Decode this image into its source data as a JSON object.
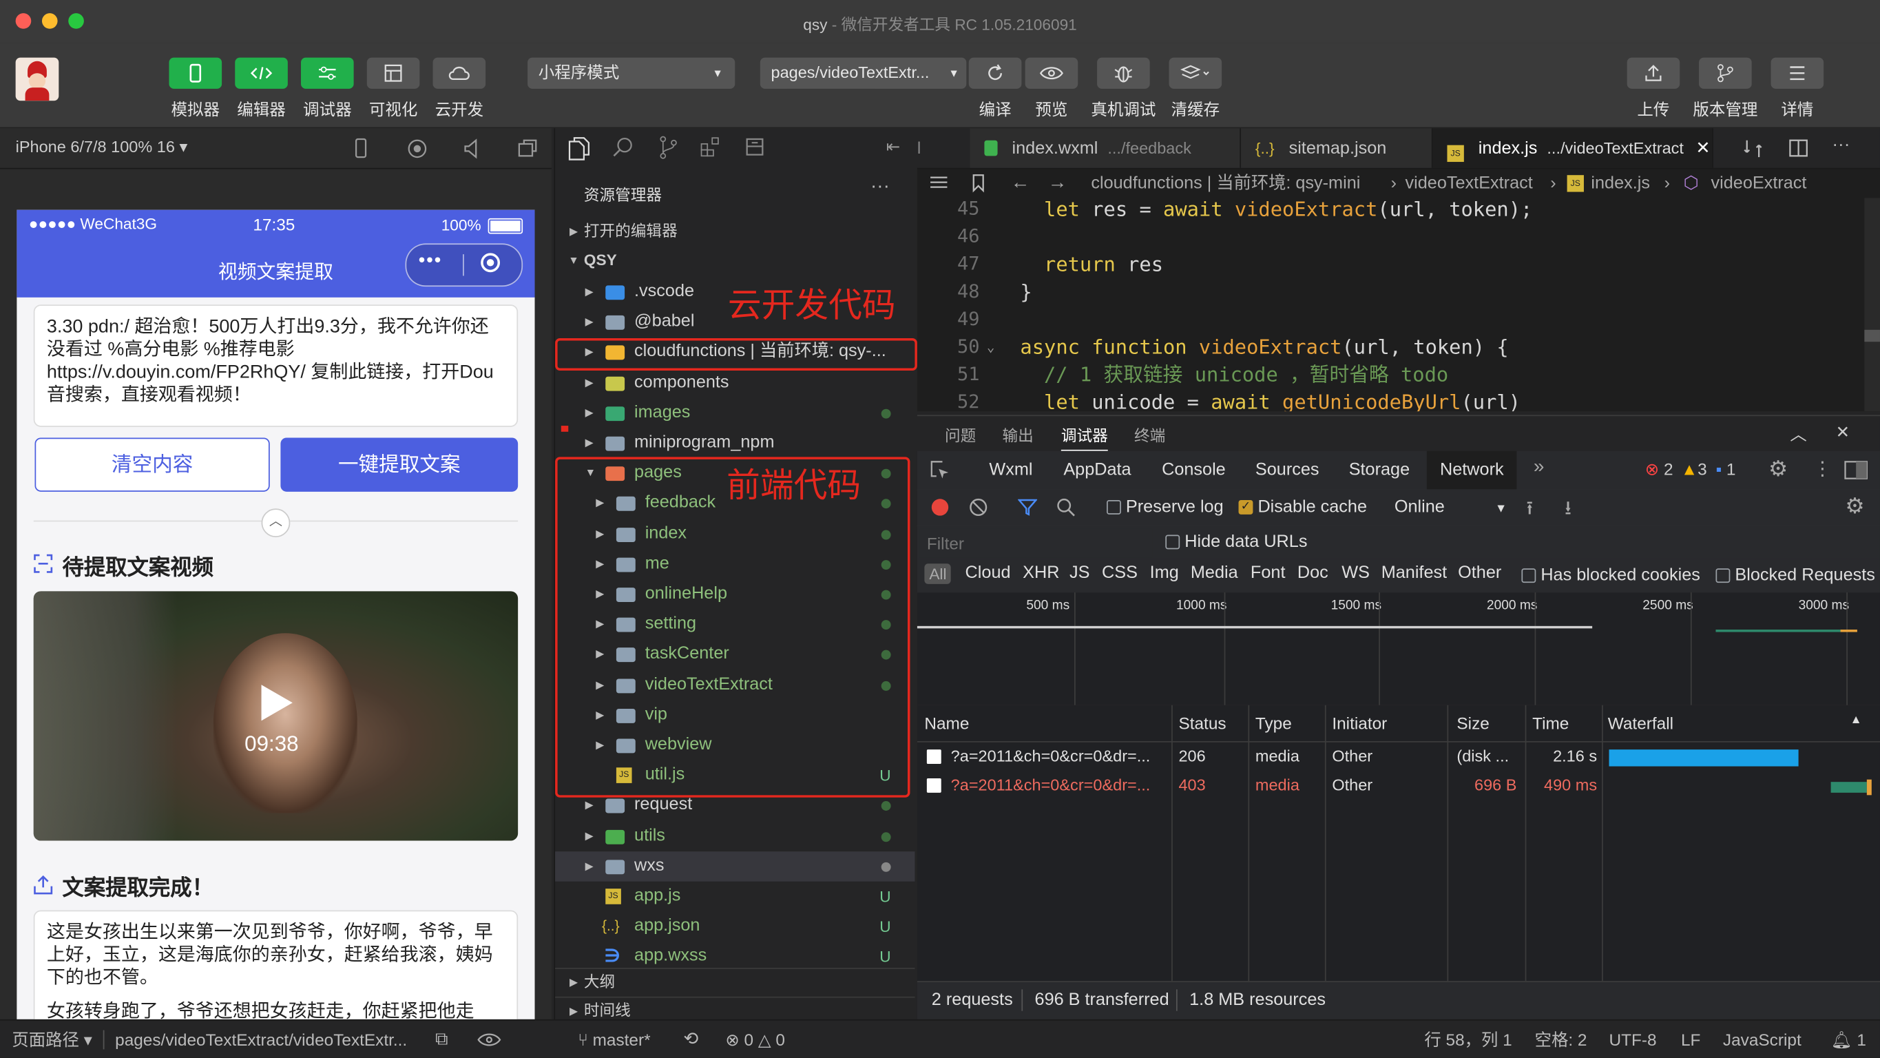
{
  "window": {
    "title": "qsy",
    "subtitle": " - 微信开发者工具 RC 1.05.2106091"
  },
  "toolbar": {
    "simulator": "模拟器",
    "editor": "编辑器",
    "debugger": "调试器",
    "visual": "可视化",
    "cloud": "云开发",
    "mode_select": "小程序模式",
    "page_select": "pages/videoTextExtr...",
    "compile": "编译",
    "preview": "预览",
    "remote_debug": "真机调试",
    "clear_cache": "清缓存",
    "upload": "上传",
    "version": "版本管理",
    "details": "详情"
  },
  "simulator": {
    "device": "iPhone 6/7/8 100% 16",
    "status_left": "●●●●● WeChat3G",
    "status_time": "17:35",
    "status_battery": "100%",
    "nav_title": "视频文案提取",
    "input_text": "3.30 pdn:/ 超治愈！500万人打出9.3分，我不允许你还没看过 %高分电影 %推荐电影  https://v.douyin.com/FP2RhQY/ 复制此链接，打开Dou音搜索，直接观看视频！",
    "clear_button": "清空内容",
    "extract_button": "一键提取文案",
    "pending_title": "待提取文案视频",
    "video_duration": "09:38",
    "done_title": "文案提取完成！",
    "result_text": "这是女孩出生以来第一次见到爷爷，你好啊，爷爷，早上好，玉立，这是海底你的亲孙女，赶紧给我滚，姨妈下的也不管。",
    "result_text_cut": "女孩转身跑了，爷爷还想把女孩赶走，你赶紧把他走"
  },
  "explorer": {
    "header": "资源管理器",
    "open_editors": "打开的编辑器",
    "project": "QSY",
    "items": [
      {
        "name": ".vscode",
        "type": "vscode"
      },
      {
        "name": "@babel",
        "type": "folder"
      },
      {
        "name": "cloudfunctions | 当前环境: qsy-...",
        "type": "cloud"
      },
      {
        "name": "components",
        "type": "comp"
      },
      {
        "name": "images",
        "type": "images"
      },
      {
        "name": "miniprogram_npm",
        "type": "folder"
      },
      {
        "name": "pages",
        "type": "pages"
      },
      {
        "name": "feedback",
        "type": "sub"
      },
      {
        "name": "index",
        "type": "sub"
      },
      {
        "name": "me",
        "type": "sub"
      },
      {
        "name": "onlineHelp",
        "type": "sub"
      },
      {
        "name": "setting",
        "type": "sub"
      },
      {
        "name": "taskCenter",
        "type": "sub"
      },
      {
        "name": "videoTextExtract",
        "type": "sub"
      },
      {
        "name": "vip",
        "type": "sub"
      },
      {
        "name": "webview",
        "type": "sub"
      },
      {
        "name": "util.js",
        "type": "js"
      },
      {
        "name": "request",
        "type": "folder"
      },
      {
        "name": "utils",
        "type": "utils"
      },
      {
        "name": "wxs",
        "type": "folder"
      },
      {
        "name": "app.js",
        "type": "js"
      },
      {
        "name": "app.json",
        "type": "json"
      },
      {
        "name": "app.wxss",
        "type": "wxss"
      }
    ],
    "outline": "大纲",
    "timeline": "时间线",
    "u_badge": "U"
  },
  "annotations": {
    "cloud": "云开发代码",
    "frontend": "前端代码"
  },
  "editor": {
    "tab1": "index.wxml",
    "tab1_path": ".../feedback",
    "tab2": "sitemap.json",
    "tab3": "index.js",
    "tab3_path": ".../videoTextExtract",
    "breadcrumb": [
      "cloudfunctions | 当前环境: qsy-mini",
      "videoTextExtract",
      "index.js",
      "videoExtract"
    ],
    "code": [
      {
        "n": "45",
        "t": "    let res = await videoExtract(url, token);"
      },
      {
        "n": "46",
        "t": ""
      },
      {
        "n": "47",
        "t": "    return res"
      },
      {
        "n": "48",
        "t": "  }"
      },
      {
        "n": "49",
        "t": ""
      },
      {
        "n": "50",
        "t": "  async function videoExtract(url, token) {"
      },
      {
        "n": "51",
        "t": "    // 1 获取链接 unicode ，暂时省略 todo"
      },
      {
        "n": "52",
        "t": "    let unicode = await getUnicodeByUrl(url)"
      }
    ]
  },
  "devtools": {
    "tabs": [
      "问题",
      "输出",
      "调试器",
      "终端"
    ],
    "panels": [
      "Wxml",
      "AppData",
      "Console",
      "Sources",
      "Storage",
      "Network"
    ],
    "errors": "2",
    "warnings": "3",
    "infos": "1",
    "preserve_log": "Preserve log",
    "disable_cache": "Disable cache",
    "throttle": "Online",
    "filter_placeholder": "Filter",
    "hide_data_urls": "Hide data URLs",
    "types": [
      "All",
      "Cloud",
      "XHR",
      "JS",
      "CSS",
      "Img",
      "Media",
      "Font",
      "Doc",
      "WS",
      "Manifest",
      "Other"
    ],
    "blocked_cookies": "Has blocked cookies",
    "blocked_requests": "Blocked Requests",
    "timeline_ticks": [
      "500 ms",
      "1000 ms",
      "1500 ms",
      "2000 ms",
      "2500 ms",
      "3000 ms"
    ],
    "columns": [
      "Name",
      "Status",
      "Type",
      "Initiator",
      "Size",
      "Time",
      "Waterfall"
    ],
    "rows": [
      {
        "name": "?a=2011&ch=0&cr=0&dr=...",
        "status": "206",
        "type": "media",
        "initiator": "Other",
        "size": "(disk ...",
        "time": "2.16 s"
      },
      {
        "name": "?a=2011&ch=0&cr=0&dr=...",
        "status": "403",
        "type": "media",
        "initiator": "Other",
        "size": "696 B",
        "time": "490 ms"
      }
    ],
    "summary_requests": "2 requests",
    "summary_transferred": "696 B transferred",
    "summary_resources": "1.8 MB resources"
  },
  "statusbar": {
    "page_path_label": "页面路径",
    "page_path": "pages/videoTextExtract/videoTextExtr...",
    "branch": "master*",
    "problems": "0",
    "warnings": "0",
    "position": "行 58，列 1",
    "spaces": "空格: 2",
    "encoding": "UTF-8",
    "eol": "LF",
    "language": "JavaScript",
    "notifications": "1"
  }
}
